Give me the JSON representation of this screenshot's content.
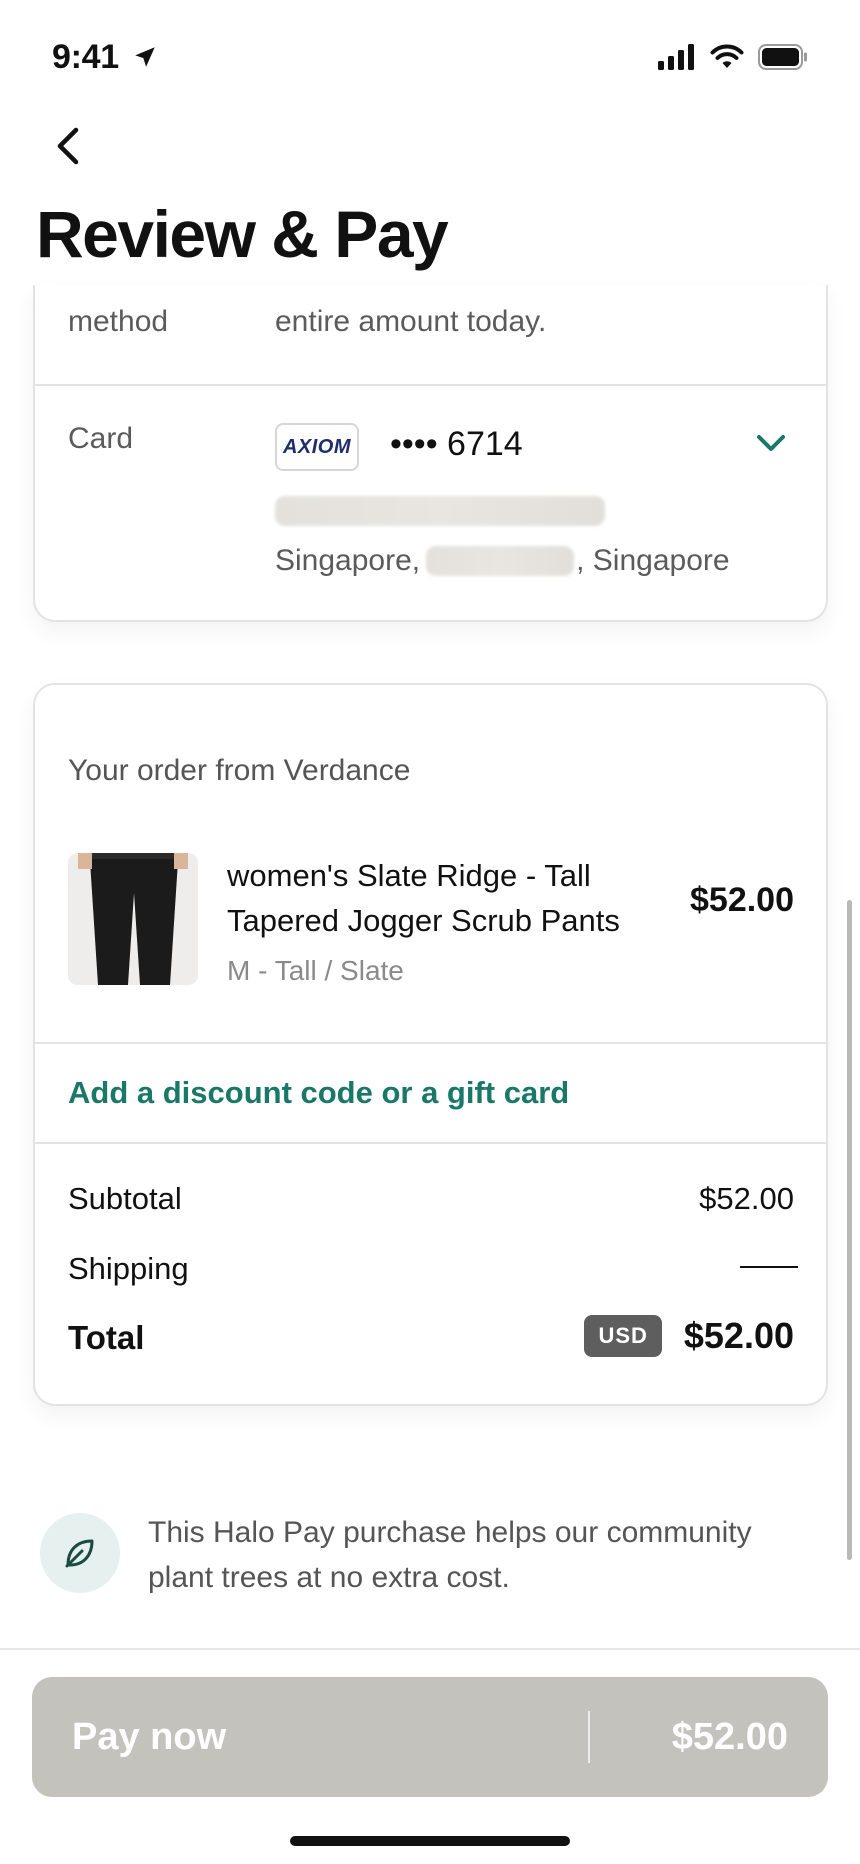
{
  "status": {
    "time": "9:41"
  },
  "header": {
    "title": "Review & Pay"
  },
  "payment": {
    "method_label": "method",
    "method_value": "entire amount today.",
    "card_label": "Card",
    "card_brand": "AXIOM",
    "card_number": "•••• 6714",
    "address_city": "Singapore,",
    "address_country": ", Singapore"
  },
  "order": {
    "heading": "Your order from Verdance",
    "item": {
      "name_line1": "women's Slate Ridge - Tall",
      "name_line2": "Tapered Jogger Scrub Pants",
      "variant": "M - Tall / Slate",
      "price": "$52.00"
    },
    "discount_link": "Add a discount code or a gift card",
    "subtotal_label": "Subtotal",
    "subtotal_value": "$52.00",
    "shipping_label": "Shipping",
    "shipping_value": "——",
    "total_label": "Total",
    "currency": "USD",
    "total_value": "$52.00"
  },
  "note": {
    "text": "This Halo Pay purchase helps our community plant trees at no extra cost."
  },
  "pay_button": {
    "label": "Pay now",
    "amount": "$52.00"
  },
  "colors": {
    "accent": "#1a7868",
    "pay_button": "#c4c2bd"
  },
  "icons": [
    "location-arrow-icon",
    "signal-icon",
    "wifi-icon",
    "battery-icon",
    "back-chevron-icon",
    "chevron-down-icon",
    "leaf-icon"
  ]
}
